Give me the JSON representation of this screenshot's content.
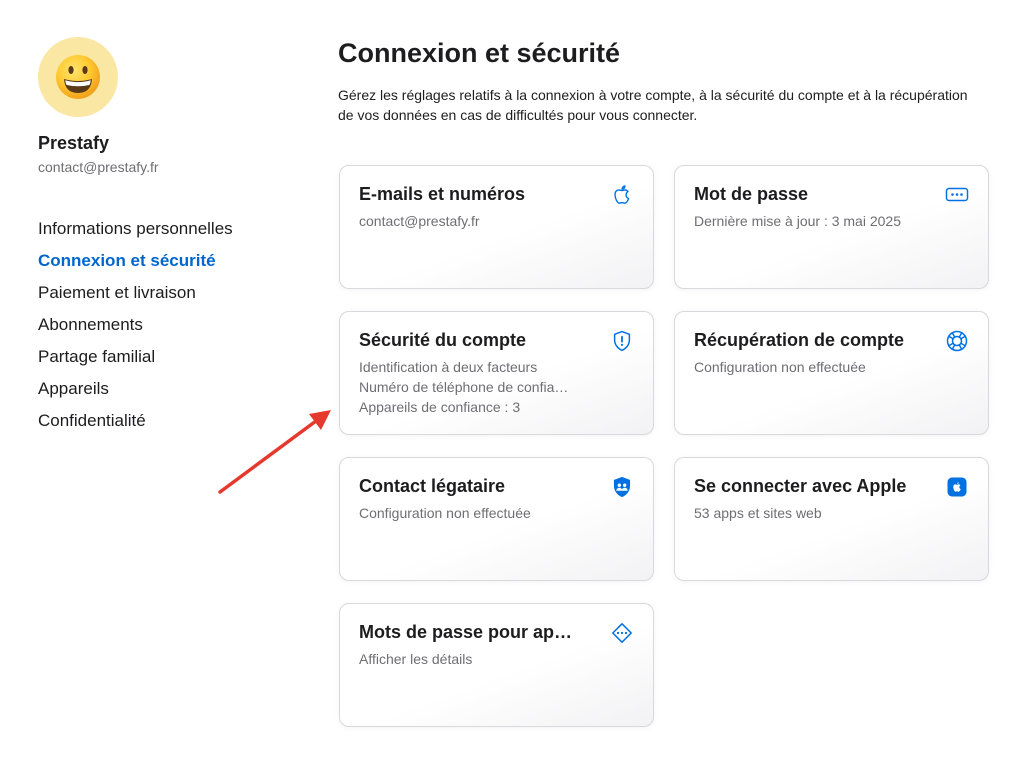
{
  "profile": {
    "name": "Prestafy",
    "email": "contact@prestafy.fr",
    "avatar_icon": "grinning-face-icon"
  },
  "sidebar": {
    "items": [
      {
        "label": "Informations personnelles",
        "active": false
      },
      {
        "label": "Connexion et sécurité",
        "active": true
      },
      {
        "label": "Paiement et livraison",
        "active": false
      },
      {
        "label": "Abonnements",
        "active": false
      },
      {
        "label": "Partage familial",
        "active": false
      },
      {
        "label": "Appareils",
        "active": false
      },
      {
        "label": "Confidentialité",
        "active": false
      }
    ]
  },
  "main": {
    "title": "Connexion et sécurité",
    "description": "Gérez les réglages relatifs à la connexion à votre compte, à la sécurité du compte et à la récupération de vos données en cas de difficultés pour vous connecter."
  },
  "cards": [
    {
      "title": "E-mails et numéros",
      "lines": [
        "contact@prestafy.fr"
      ],
      "icon": "apple-icon"
    },
    {
      "title": "Mot de passe",
      "lines": [
        "Dernière mise à jour : 3 mai 2025"
      ],
      "icon": "password-field-icon"
    },
    {
      "title": "Sécurité du compte",
      "lines": [
        "Identification à deux facteurs",
        "Numéro de téléphone de confia…",
        "Appareils de confiance : 3"
      ],
      "icon": "shield-exclamation-icon"
    },
    {
      "title": "Récupération de compte",
      "lines": [
        "Configuration non effectuée"
      ],
      "icon": "lifebuoy-icon"
    },
    {
      "title": "Contact légataire",
      "lines": [
        "Configuration non effectuée"
      ],
      "icon": "shield-people-icon"
    },
    {
      "title": "Se connecter avec Apple",
      "lines": [
        "53 apps et sites web"
      ],
      "icon": "apple-square-icon"
    },
    {
      "title": "Mots de passe pour ap…",
      "lines": [
        "Afficher les détails"
      ],
      "icon": "diamond-dots-icon"
    }
  ],
  "annotation": {
    "icon": "red-arrow-icon"
  },
  "colors": {
    "accent": "#0066cc",
    "icon": "#0071e3",
    "text": "#1d1d1f",
    "secondary": "#6e6e73",
    "annotation": "#e5392d",
    "avatar_bg": "#fbe7a4"
  }
}
